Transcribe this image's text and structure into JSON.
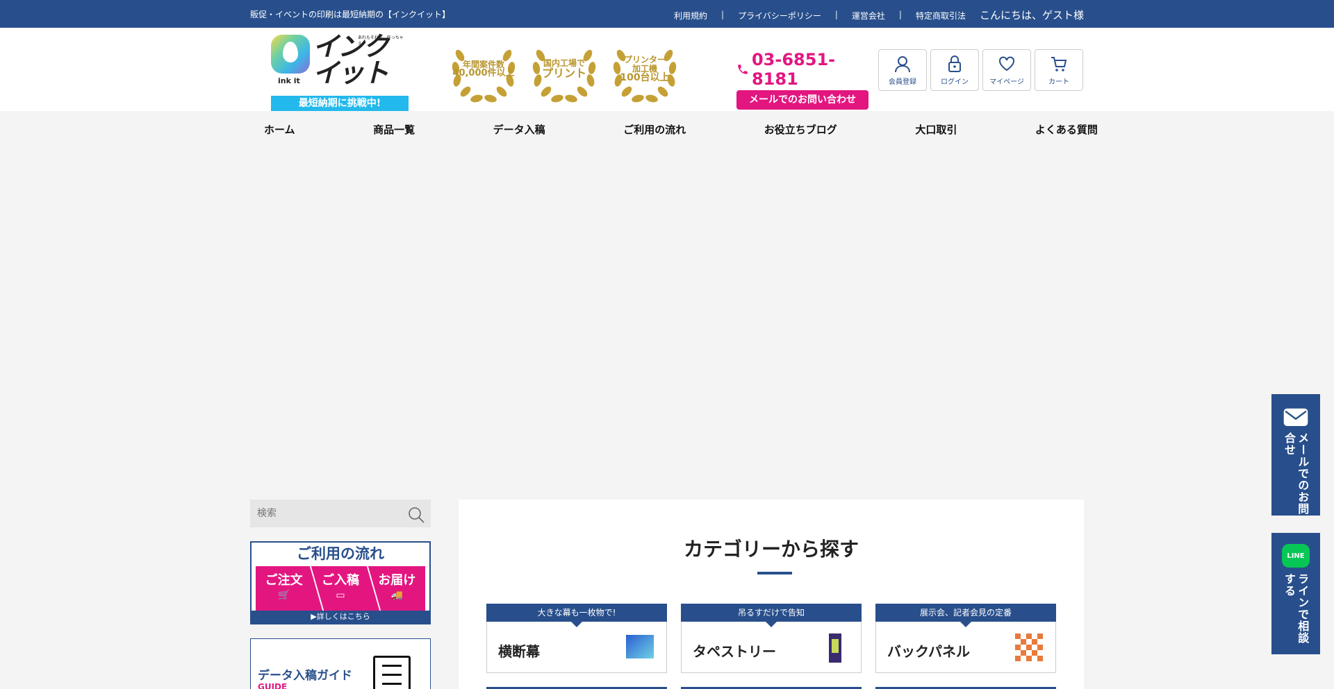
{
  "topbar": {
    "tagline": "販促・イベントの印刷は最短納期の【インクイット】",
    "links": [
      "利用規約",
      "プライバシーポリシー",
      "運営会社",
      "特定商取引法"
    ],
    "greeting": "こんにちは、ゲスト様"
  },
  "logo": {
    "small_text": "あれもそれも、作っちゃえ。",
    "wordmark": "インクイット",
    "ink_it": "ink it",
    "band": "最短納期に挑戦中!"
  },
  "badges": [
    {
      "line1": "年間案件数",
      "line2": "40,000件以上"
    },
    {
      "line1": "国内工場で",
      "line2": "プリント"
    },
    {
      "line1": "プリンター加工機",
      "line2": "100台以上"
    }
  ],
  "contact": {
    "phone": "03-6851-8181",
    "mail_button": "メールでのお問い合わせ"
  },
  "icon_buttons": [
    {
      "label": "会員登録",
      "icon": "user-icon"
    },
    {
      "label": "ログイン",
      "icon": "lock-icon"
    },
    {
      "label": "マイページ",
      "icon": "heart-icon"
    },
    {
      "label": "カート",
      "icon": "cart-icon"
    }
  ],
  "nav": [
    "ホーム",
    "商品一覧",
    "データ入稿",
    "ご利用の流れ",
    "お役立ちブログ",
    "大口取引",
    "よくある質問"
  ],
  "search": {
    "placeholder": "検索"
  },
  "flow_banner": {
    "title": "ご利用の流れ",
    "steps": [
      "ご注文",
      "ご入稿",
      "お届け"
    ],
    "more": "▶詳しくはこちら"
  },
  "data_guide": {
    "title": "データ入稿ガイド",
    "sub": "GUIDE"
  },
  "main": {
    "heading": "カテゴリーから探す",
    "categories": [
      {
        "tag": "大きな幕も一枚物で!",
        "name": "横断幕"
      },
      {
        "tag": "吊るすだけで告知",
        "name": "タペストリー"
      },
      {
        "tag": "展示会、記者会見の定番",
        "name": "バックパネル"
      }
    ]
  },
  "side_tabs": {
    "mail": "メールでのお問合せ",
    "line": "ラインで相談する",
    "line_logo": "LINE"
  },
  "colors": {
    "primary": "#284f8c",
    "accent": "#e31680",
    "gold": "#b8962e"
  }
}
